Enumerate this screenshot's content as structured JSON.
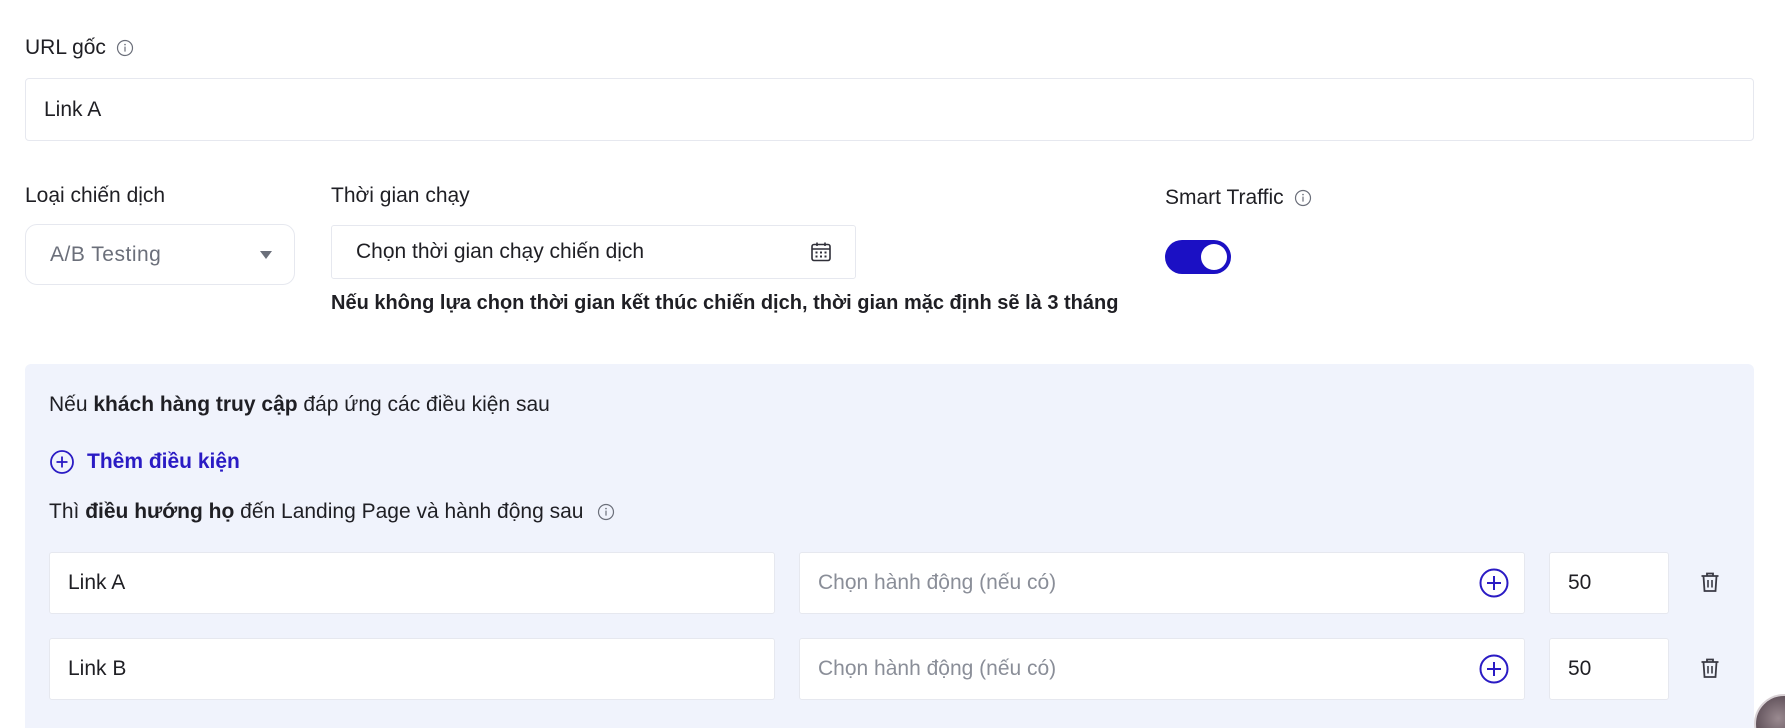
{
  "url_section": {
    "label": "URL gốc",
    "value": "Link A"
  },
  "campaign_type": {
    "label": "Loại chiến dịch",
    "selected": "A/B Testing"
  },
  "run_time": {
    "label": "Thời gian chạy",
    "placeholder": "Chọn thời gian chạy chiến dịch",
    "note": "Nếu không lựa chọn thời gian kết thúc chiến dịch, thời gian mặc định sẽ là 3 tháng"
  },
  "smart_traffic": {
    "label": "Smart Traffic",
    "enabled": true,
    "accent": "#1b10c4"
  },
  "rules": {
    "condition_prefix": "Nếu ",
    "condition_bold": "khách hàng truy cập",
    "condition_suffix": " đáp ứng các điều kiện sau",
    "add_condition_label": "Thêm điều kiện",
    "then_prefix": "Thì ",
    "then_bold": "điều hướng họ",
    "then_suffix": " đến Landing Page và hành động sau",
    "rows": [
      {
        "landing_page": "Link A",
        "action_placeholder": "Chọn hành động (nếu có)",
        "percent": "50"
      },
      {
        "landing_page": "Link B",
        "action_placeholder": "Chọn hành động (nếu có)",
        "percent": "50"
      }
    ]
  },
  "colors": {
    "panel_bg": "#f0f3fc",
    "link_blue": "#2a1bc4",
    "border": "#e6e8ef"
  }
}
